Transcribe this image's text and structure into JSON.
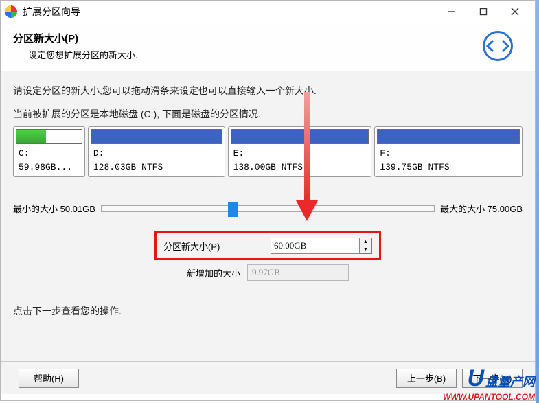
{
  "titlebar": {
    "title": "扩展分区向导"
  },
  "header": {
    "heading": "分区新大小(P)",
    "sub": "设定您想扩展分区的新大小."
  },
  "instruction": "请设定分区的新大小,您可以拖动滑条来设定也可以直接输入一个新大小.",
  "current_partition": "当前被扩展的分区是本地磁盘 (C:), 下面是磁盘的分区情况.",
  "partitions": {
    "c": {
      "drive": "C:",
      "size": "59.98GB..."
    },
    "d": {
      "drive": "D:",
      "size": "128.03GB NTFS"
    },
    "e": {
      "drive": "E:",
      "size": "138.00GB NTFS"
    },
    "f": {
      "drive": "F:",
      "size": "139.75GB NTFS"
    }
  },
  "slider": {
    "min_label": "最小的大小 50.01GB",
    "max_label": "最大的大小 75.00GB"
  },
  "size_box": {
    "label": "分区新大小(P)",
    "value": "60.00GB"
  },
  "added": {
    "label": "新增加的大小",
    "value": "9.97GB"
  },
  "click_next": "点击下一步查看您的操作.",
  "buttons": {
    "help": "帮助(H)",
    "back": "上一步(B)",
    "next": "下一步(N)"
  },
  "watermark": {
    "brand": "U",
    "cn": "盘量产网",
    "url": "WWW.UPANTOOL.COM"
  }
}
